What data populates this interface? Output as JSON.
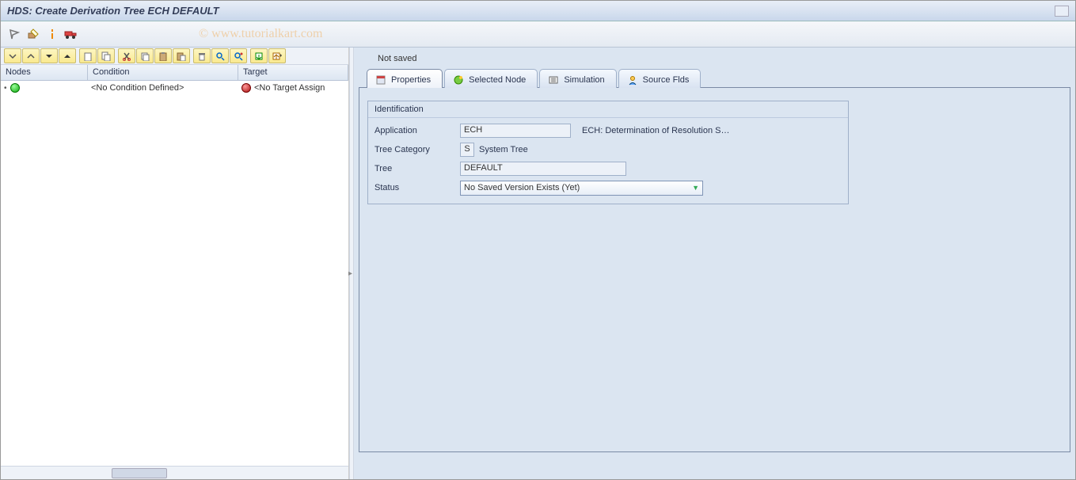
{
  "title": "HDS: Create Derivation Tree ECH DEFAULT",
  "watermark": "© www.tutorialkart.com",
  "tree": {
    "columns": {
      "nodes": "Nodes",
      "condition": "Condition",
      "target": "Target"
    },
    "rows": [
      {
        "condition": "<No Condition Defined>",
        "target": "<No Target Assign"
      }
    ]
  },
  "right": {
    "status": "Not saved",
    "tabs": {
      "properties": "Properties",
      "selected": "Selected Node",
      "simulation": "Simulation",
      "source": "Source Flds"
    },
    "panel": {
      "title": "Identification",
      "application_label": "Application",
      "application_value": "ECH",
      "application_desc": "ECH: Determination of Resolution S…",
      "category_label": "Tree Category",
      "category_code": "S",
      "category_text": "System Tree",
      "tree_label": "Tree",
      "tree_value": "DEFAULT",
      "status_label": "Status",
      "status_value": "No Saved Version Exists (Yet)"
    }
  }
}
